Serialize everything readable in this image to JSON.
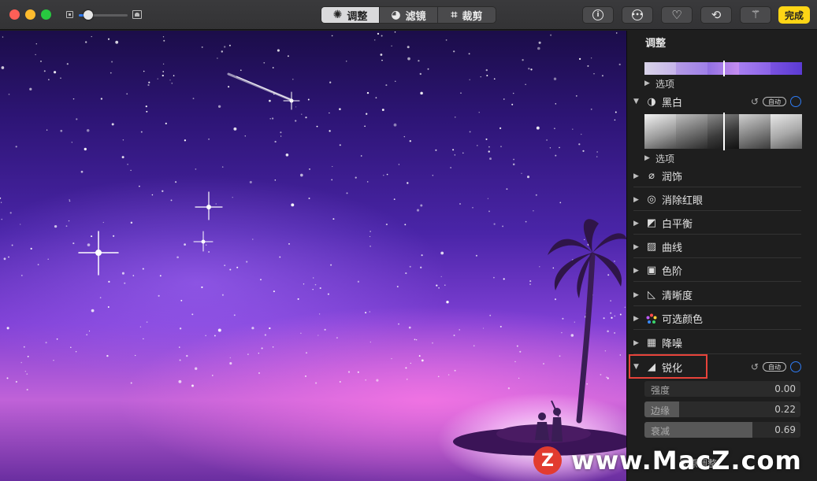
{
  "toolbar": {
    "tabs": [
      {
        "label": "调整",
        "icon": "dial-icon",
        "active": true
      },
      {
        "label": "滤镜",
        "icon": "filter-circles-icon",
        "active": false
      },
      {
        "label": "裁剪",
        "icon": "crop-icon",
        "active": false
      }
    ],
    "info_glyph": "i",
    "done_label": "完成",
    "zoom_level": 0.2
  },
  "panel": {
    "title": "调整",
    "options_label": "选项",
    "auto_label": "自动",
    "sections": [
      {
        "label": "黑白",
        "icon": "half-circle-icon",
        "expanded": true
      },
      {
        "label": "润饰",
        "icon": "bandage-icon"
      },
      {
        "label": "消除红眼",
        "icon": "eye-icon"
      },
      {
        "label": "白平衡",
        "icon": "white-balance-icon"
      },
      {
        "label": "曲线",
        "icon": "curves-icon"
      },
      {
        "label": "色阶",
        "icon": "levels-icon"
      },
      {
        "label": "清晰度",
        "icon": "definition-icon"
      },
      {
        "label": "可选颜色",
        "icon": "color-dots-icon"
      },
      {
        "label": "降噪",
        "icon": "noise-icon"
      },
      {
        "label": "锐化",
        "icon": "sharpen-icon",
        "expanded": true
      }
    ],
    "sharpen_sliders": [
      {
        "label": "强度",
        "value": "0.00",
        "level": 0.0
      },
      {
        "label": "边缘",
        "value": "0.22",
        "level": 0.22
      },
      {
        "label": "衰减",
        "value": "0.69",
        "level": 0.69
      }
    ],
    "revert_label": "还原调整"
  },
  "colors": {
    "accent": "#2f7cf6",
    "done": "#fdd516",
    "highlight": "#e8433a"
  },
  "watermark": {
    "logo": "Z",
    "text": "www.MacZ.com"
  }
}
